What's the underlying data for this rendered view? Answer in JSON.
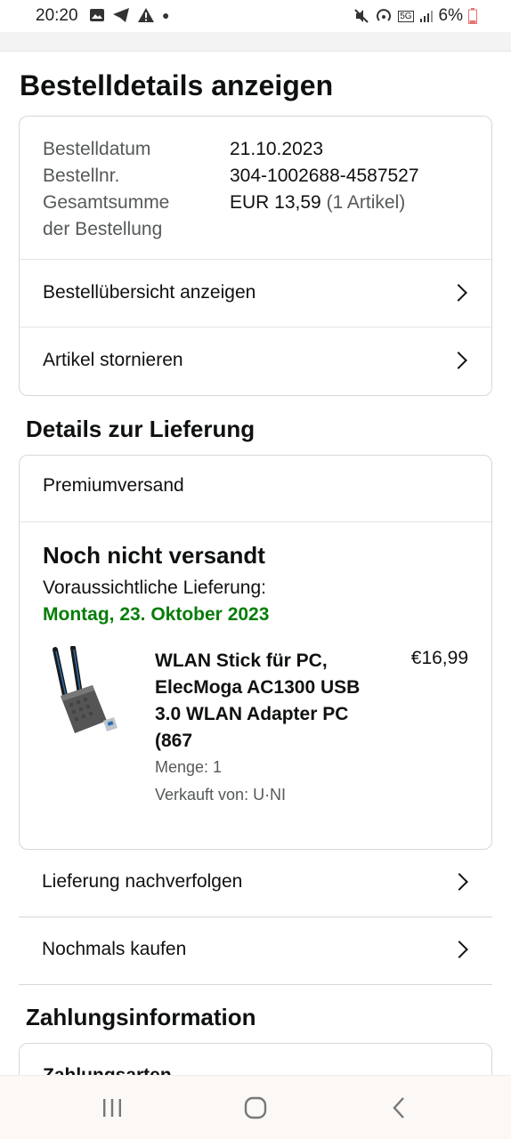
{
  "status_bar": {
    "time": "20:20",
    "battery": "6%",
    "network_badge": "5G"
  },
  "page_title": "Bestelldetails anzeigen",
  "order_summary": {
    "date_label": "Bestelldatum",
    "date_value": "21.10.2023",
    "number_label": "Bestellnr.",
    "number_value": "304-1002688-4587527",
    "total_label_line1": "Gesamtsumme",
    "total_label_line2": "der Bestellung",
    "total_value": "EUR 13,59",
    "total_items": "(1 Artikel)",
    "link_overview": "Bestellübersicht anzeigen",
    "link_cancel": "Artikel stornieren"
  },
  "delivery": {
    "section_title": "Details zur Lieferung",
    "shipping_type": "Premiumversand",
    "status": "Noch nicht versandt",
    "eta_label": "Voraussichtliche Lieferung:",
    "eta_date": "Montag, 23. Oktober 2023",
    "product": {
      "title": "WLAN Stick für PC, ElecMoga AC1300 USB 3.0 WLAN Adapter PC (867",
      "price": "€16,99",
      "quantity": "Menge: 1",
      "seller": "Verkauft von: U·NI"
    },
    "link_track": "Lieferung nachverfolgen",
    "link_buy_again": "Nochmals kaufen"
  },
  "payment": {
    "section_title": "Zahlungsinformation",
    "card_heading": "Zahlungsarten"
  },
  "colors": {
    "eta_green": "#067d08",
    "border": "#d5d9d9",
    "muted_text": "#565959"
  }
}
